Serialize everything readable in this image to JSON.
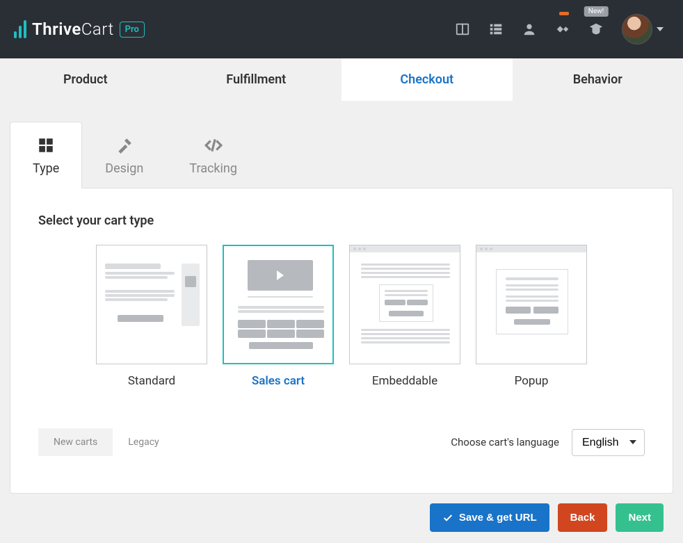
{
  "header": {
    "brand_first": "Thrive",
    "brand_second": "Cart",
    "pro_label": "Pro",
    "new_badge": "New!"
  },
  "nav": {
    "tabs": [
      {
        "label": "Product"
      },
      {
        "label": "Fulfillment"
      },
      {
        "label": "Checkout"
      },
      {
        "label": "Behavior"
      }
    ]
  },
  "subtabs": {
    "type": "Type",
    "design": "Design",
    "tracking": "Tracking"
  },
  "panel": {
    "title": "Select your cart type",
    "options": {
      "standard": "Standard",
      "sales": "Sales cart",
      "embed": "Embeddable",
      "popup": "Popup"
    }
  },
  "modes": {
    "new": "New carts",
    "legacy": "Legacy"
  },
  "language": {
    "label": "Choose cart's language",
    "selected": "English"
  },
  "buttons": {
    "save": "Save & get URL",
    "back": "Back",
    "next": "Next"
  }
}
